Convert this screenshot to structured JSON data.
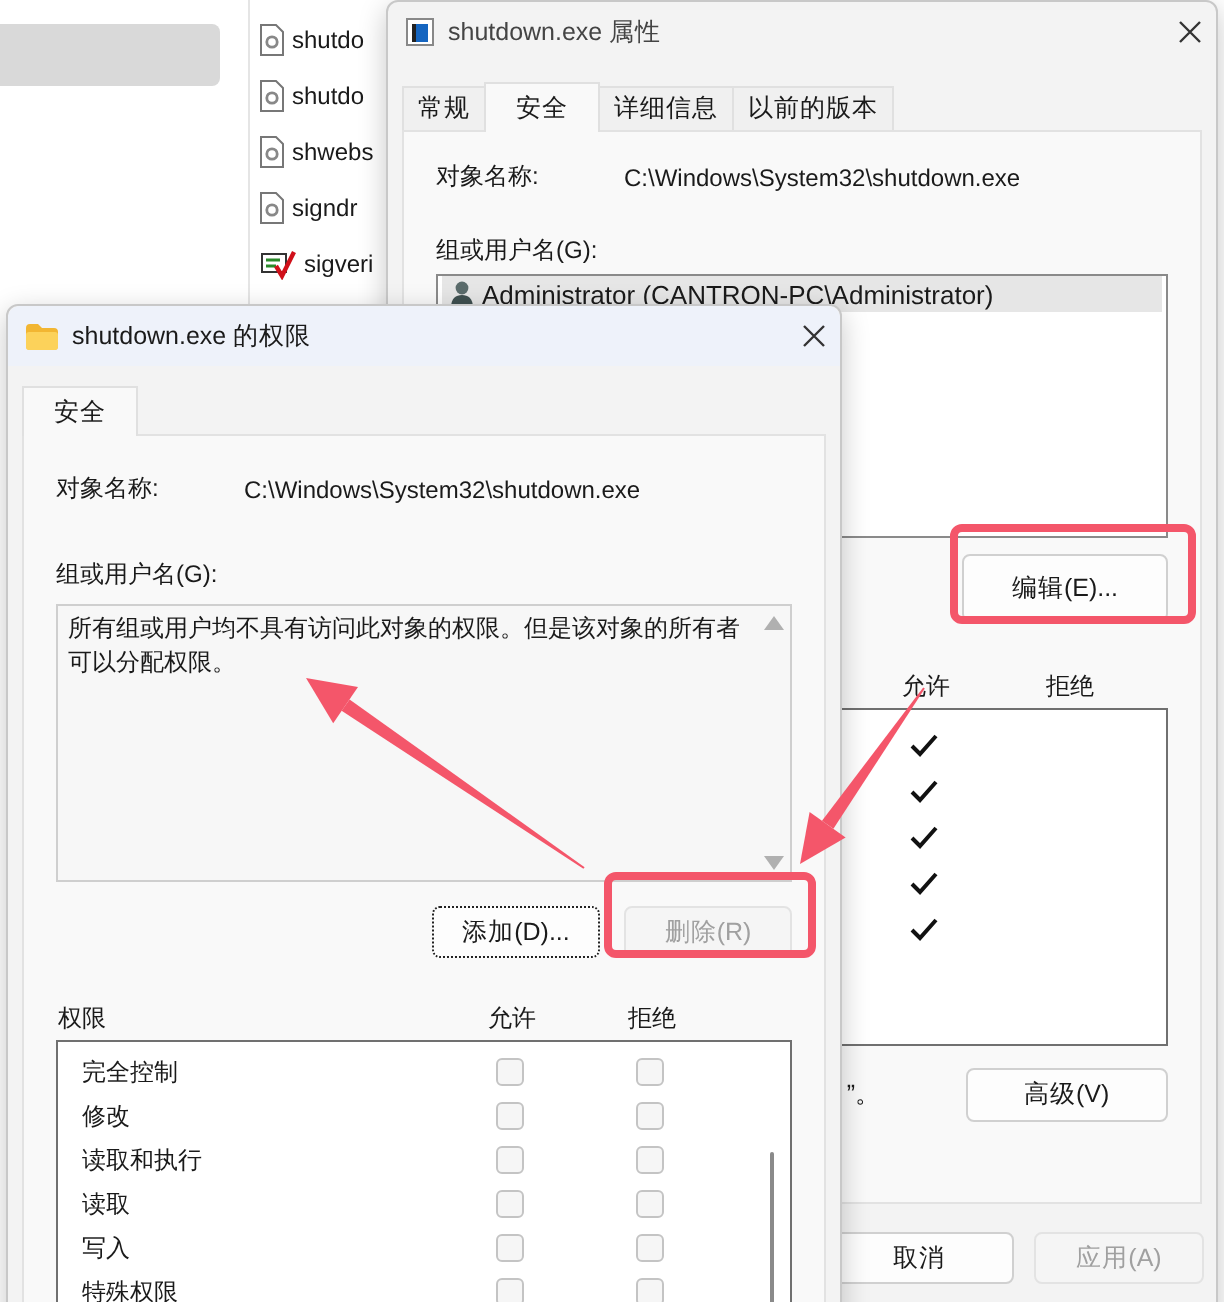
{
  "explorer": {
    "sidebar": {
      "items": [
        {
          "selected": true
        }
      ]
    },
    "files": [
      {
        "name": "shutdo",
        "kind": "document"
      },
      {
        "name": "shutdo",
        "kind": "document"
      },
      {
        "name": "shwebs",
        "kind": "document"
      },
      {
        "name": "signdr",
        "kind": "document"
      },
      {
        "name": "sigveri",
        "kind": "tool"
      }
    ]
  },
  "properties_window": {
    "title": "shutdown.exe 属性",
    "tabs": [
      {
        "label": "常规",
        "selected": false
      },
      {
        "label": "安全",
        "selected": true
      },
      {
        "label": "详细信息",
        "selected": false
      },
      {
        "label": "以前的版本",
        "selected": false
      }
    ],
    "object_label": "对象名称:",
    "object_value": "C:\\Windows\\System32\\shutdown.exe",
    "group_label": "组或用户名(G):",
    "users": [
      {
        "name": "Administrator (CANTRON-PC\\Administrator)",
        "selected": true
      }
    ],
    "edit_button": "编辑(E)...",
    "permission_columns": [
      "允许",
      "拒绝"
    ],
    "permissions": [
      {
        "allow": true,
        "deny": false
      },
      {
        "allow": true,
        "deny": false
      },
      {
        "allow": true,
        "deny": false
      },
      {
        "allow": true,
        "deny": false
      },
      {
        "allow": true,
        "deny": false
      }
    ],
    "advanced_note": "”。",
    "advanced_button": "高级(V)",
    "buttons": [
      {
        "label": "取消",
        "disabled": false
      },
      {
        "label": "应用(A)",
        "disabled": true
      }
    ]
  },
  "permissions_dialog": {
    "title": "shutdown.exe 的权限",
    "tabs": [
      {
        "label": "安全",
        "selected": true
      }
    ],
    "object_label": "对象名称:",
    "object_value": "C:\\Windows\\System32\\shutdown.exe",
    "group_label": "组或用户名(G):",
    "message": "所有组或用户均不具有访问此对象的权限。但是该对象的所有者可以分配权限。",
    "buttons": [
      {
        "label": "添加(D)...",
        "focused": true,
        "disabled": false
      },
      {
        "label": "删除(R)",
        "focused": false,
        "disabled": true
      }
    ],
    "permission_columns": [
      "权限",
      "允许",
      "拒绝"
    ],
    "permissions": [
      {
        "name": "完全控制",
        "allow": false,
        "deny": false
      },
      {
        "name": "修改",
        "allow": false,
        "deny": false
      },
      {
        "name": "读取和执行",
        "allow": false,
        "deny": false
      },
      {
        "name": "读取",
        "allow": false,
        "deny": false
      },
      {
        "name": "写入",
        "allow": false,
        "deny": false
      },
      {
        "name": "特殊权限",
        "allow": false,
        "deny": false
      }
    ]
  }
}
